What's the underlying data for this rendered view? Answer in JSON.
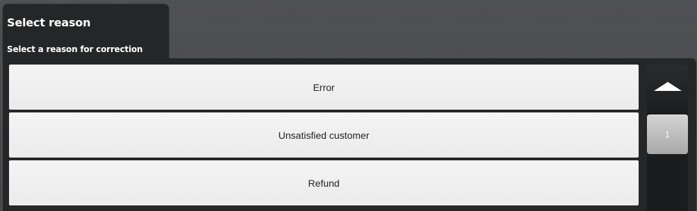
{
  "header": {
    "title": "Select reason",
    "subtitle": "Select a reason for correction"
  },
  "reasons": [
    {
      "label": "Error"
    },
    {
      "label": "Unsatisfied customer"
    },
    {
      "label": "Refund"
    }
  ],
  "scroll": {
    "up_icon": "arrow-up-icon",
    "page": "1"
  },
  "colors": {
    "background": "#4a4b4d",
    "panel": "#252627",
    "item": "#ececec",
    "item_text": "#222222",
    "thumb": "#bcbcbc"
  }
}
